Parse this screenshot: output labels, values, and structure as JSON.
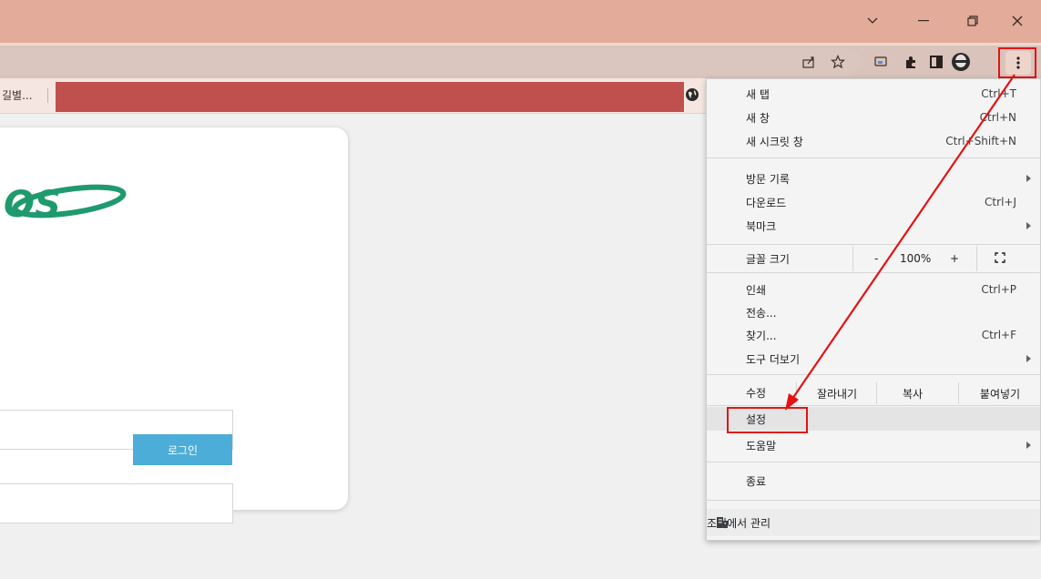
{
  "window": {
    "minimize_glyph": "—",
    "restore_glyph": "❐",
    "close_glyph": "✕",
    "dropdown_glyph": "⌄"
  },
  "toolbar": {
    "icons": [
      "share-icon",
      "star-icon",
      "cast-icon",
      "extensions-icon",
      "side-panel-icon",
      "profile-icon",
      "more-menu-icon"
    ]
  },
  "bookmarks": {
    "item_label": "길별..."
  },
  "login": {
    "logo_text": "OS",
    "button_label": "로그인",
    "logo_color": "#1f9a6e",
    "button_color": "#4badd8"
  },
  "menu": {
    "new_tab": "새 탭",
    "new_tab_sc": "Ctrl+T",
    "new_window": "새 창",
    "new_window_sc": "Ctrl+N",
    "incognito": "새 시크릿 창",
    "incognito_sc": "Ctrl+Shift+N",
    "history": "방문 기록",
    "downloads": "다운로드",
    "downloads_sc": "Ctrl+J",
    "bookmarks": "북마크",
    "zoom_label": "글꼴 크기",
    "zoom_minus": "-",
    "zoom_value": "100%",
    "zoom_plus": "+",
    "print": "인쇄",
    "print_sc": "Ctrl+P",
    "cast": "전송...",
    "find": "찾기...",
    "find_sc": "Ctrl+F",
    "more_tools": "도구 더보기",
    "edit": "수정",
    "cut": "잘라내기",
    "copy": "복사",
    "paste": "붙여넣기",
    "settings": "설정",
    "help": "도움말",
    "exit": "종료",
    "managed": "조직에서 관리"
  },
  "annotation_color": "#e31313"
}
